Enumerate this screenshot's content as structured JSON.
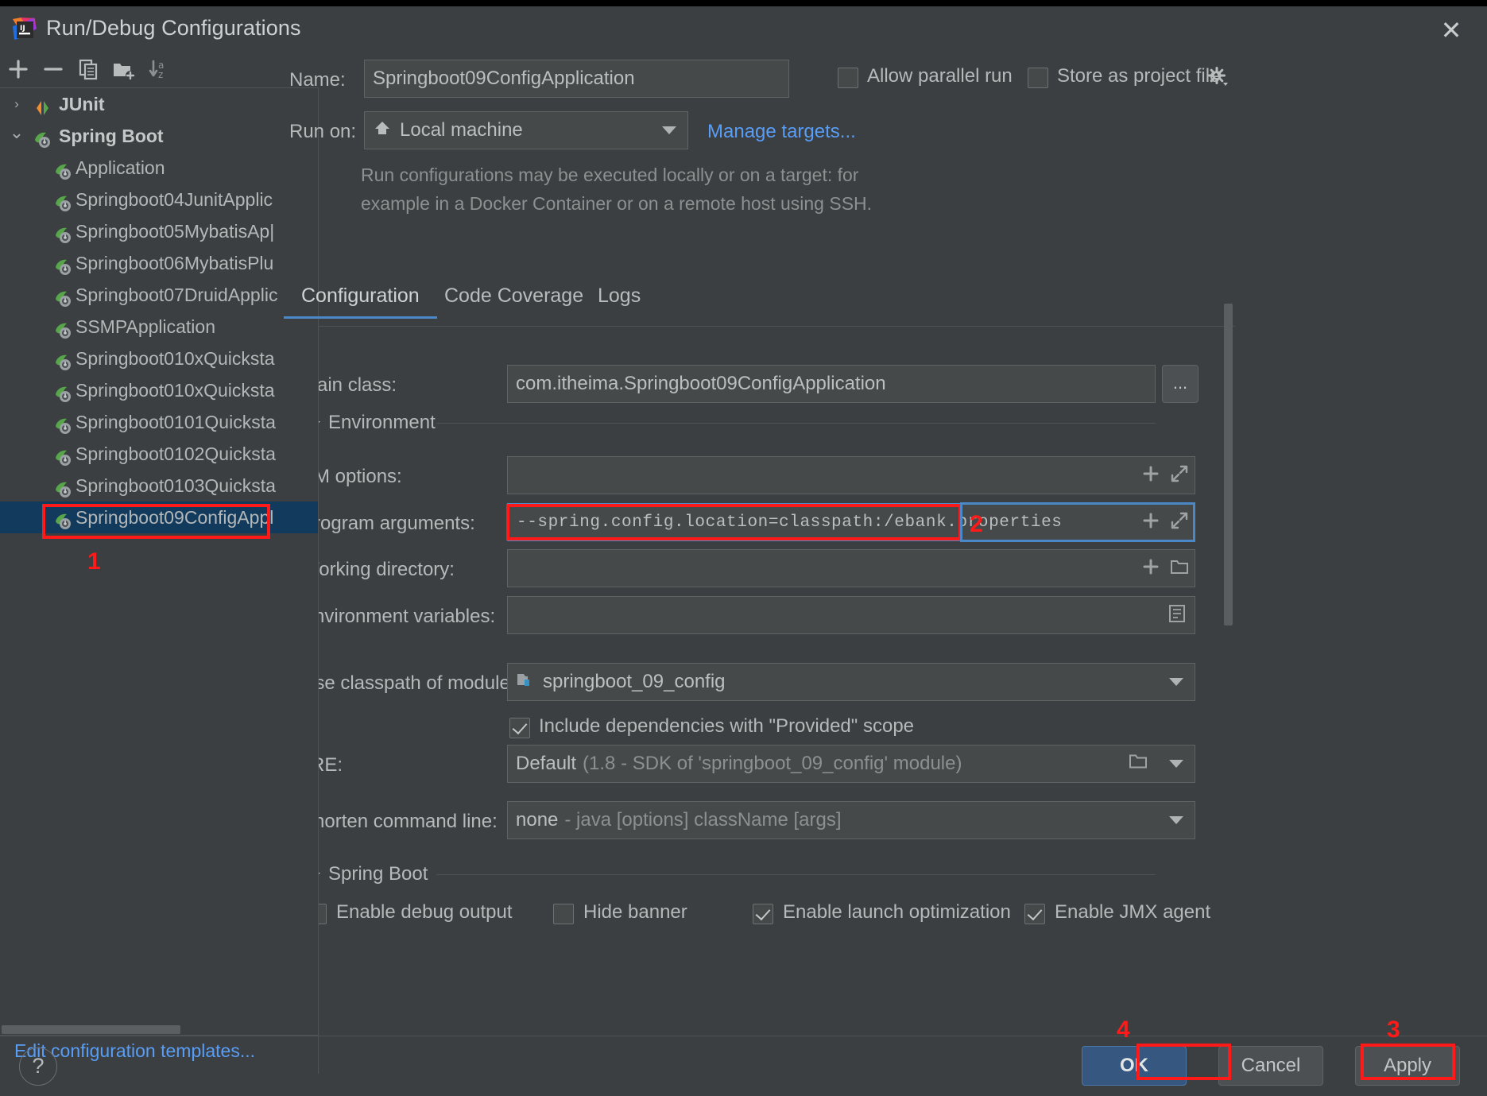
{
  "window": {
    "title": "Run/Debug Configurations",
    "app_icon": "intellij-idea-icon",
    "close_label": "✕"
  },
  "toolbar": {
    "buttons": [
      {
        "name": "add-configuration-button",
        "icon": "plus-icon",
        "label": "+"
      },
      {
        "name": "remove-configuration-button",
        "icon": "minus-icon",
        "label": "−"
      },
      {
        "name": "copy-configuration-button",
        "icon": "copy-icon",
        "label": "Copy"
      },
      {
        "name": "new-folder-button",
        "icon": "folder-add-icon",
        "label": "New Folder"
      },
      {
        "name": "sort-configurations-button",
        "icon": "sort-alphabetical-icon",
        "label": "Sort"
      }
    ]
  },
  "tree": {
    "items": [
      {
        "label": "JUnit",
        "type": "group",
        "icon": "junit-icon",
        "expanded": false,
        "arrow": "›",
        "selected": false
      },
      {
        "label": "Spring Boot",
        "type": "group",
        "icon": "spring-boot-icon",
        "expanded": true,
        "arrow": "⌄",
        "selected": false
      },
      {
        "label": "Application",
        "type": "child",
        "icon": "spring-boot-icon",
        "selected": false
      },
      {
        "label": "Springboot04JunitApplic",
        "type": "child",
        "icon": "spring-boot-icon",
        "selected": false
      },
      {
        "label": "Springboot05MybatisAp|",
        "type": "child",
        "icon": "spring-boot-icon",
        "selected": false
      },
      {
        "label": "Springboot06MybatisPlu",
        "type": "child",
        "icon": "spring-boot-icon",
        "selected": false
      },
      {
        "label": "Springboot07DruidApplic",
        "type": "child",
        "icon": "spring-boot-icon",
        "selected": false
      },
      {
        "label": "SSMPApplication",
        "type": "child",
        "icon": "spring-boot-icon",
        "selected": false
      },
      {
        "label": "Springboot010xQuicksta",
        "type": "child",
        "icon": "spring-boot-icon",
        "selected": false
      },
      {
        "label": "Springboot010xQuicksta",
        "type": "child",
        "icon": "spring-boot-icon",
        "selected": false
      },
      {
        "label": "Springboot0101Quicksta",
        "type": "child",
        "icon": "spring-boot-icon",
        "selected": false
      },
      {
        "label": "Springboot0102Quicksta",
        "type": "child",
        "icon": "spring-boot-icon",
        "selected": false
      },
      {
        "label": "Springboot0103Quicksta",
        "type": "child",
        "icon": "spring-boot-icon",
        "selected": false
      },
      {
        "label": "Springboot09ConfigAppl",
        "type": "child",
        "icon": "spring-boot-icon",
        "selected": true
      }
    ],
    "edit_templates_link": "Edit configuration templates..."
  },
  "form": {
    "name_label": "Name:",
    "name_value": "Springboot09ConfigApplication",
    "run_on_label": "Run on:",
    "run_on_value": "Local machine",
    "run_on_icon": "home-icon",
    "manage_targets_link": "Manage targets...",
    "allow_parallel_run_label": "Allow parallel run",
    "allow_parallel_run_checked": false,
    "store_as_project_file_label": "Store as project file",
    "store_as_project_file_checked": false,
    "store_gear_icon": "gear-icon",
    "hint_line_1": "Run configurations may be executed locally or on a target: for",
    "hint_line_2": "example in a Docker Container or on a remote host using SSH."
  },
  "tabs": [
    {
      "label": "Configuration",
      "active": true
    },
    {
      "label": "Code Coverage",
      "active": false
    },
    {
      "label": "Logs",
      "active": false
    }
  ],
  "configuration": {
    "main_class_label": "Main class:",
    "main_class_value": "com.itheima.Springboot09ConfigApplication",
    "main_class_browse_label": "...",
    "environment_section": "Environment",
    "vm_options_label": "VM options:",
    "vm_options_value": "",
    "program_arguments_label": "Program arguments:",
    "program_arguments_value": "--spring.config.location=classpath:/ebank.properties",
    "working_directory_label": "Working directory:",
    "working_directory_value": "",
    "environment_variables_label": "Environment variables:",
    "environment_variables_value": "",
    "use_classpath_label": "Use classpath of module:",
    "use_classpath_value": "springboot_09_config",
    "use_classpath_icon": "module-icon",
    "include_provided_label": "Include dependencies with \"Provided\" scope",
    "include_provided_checked": true,
    "jre_label": "JRE:",
    "jre_value": "Default",
    "jre_value_suffix": "(1.8 - SDK of 'springboot_09_config' module)",
    "shorten_cmd_label": "Shorten command line:",
    "shorten_cmd_value": "none",
    "shorten_cmd_suffix": "- java [options] className [args]",
    "spring_boot_section": "Spring Boot",
    "spring_checkboxes": [
      {
        "label": "Enable debug output",
        "checked": false
      },
      {
        "label": "Hide banner",
        "checked": false
      },
      {
        "label": "Enable launch optimization",
        "checked": true
      },
      {
        "label": "Enable JMX agent",
        "checked": true
      }
    ],
    "expand_icon": "expand-diagonal-icon",
    "insert_macro_icon": "plus-icon",
    "browse_folder_icon": "folder-icon",
    "env_vars_edit_icon": "list-edit-icon"
  },
  "footer": {
    "help_label": "?",
    "ok_label": "OK",
    "cancel_label": "Cancel",
    "apply_label": "Apply"
  },
  "annotations": [
    {
      "number": "1",
      "target": "tree-selected-item"
    },
    {
      "number": "2",
      "target": "program-arguments-field"
    },
    {
      "number": "3",
      "target": "apply-button"
    },
    {
      "number": "4",
      "target": "ok-button"
    }
  ],
  "colors": {
    "annotation_red": "#ff1a1a",
    "accent_blue": "#589df6",
    "primary_button": "#365880",
    "selection": "#113a5c",
    "panel_bg": "#3c3f41"
  }
}
